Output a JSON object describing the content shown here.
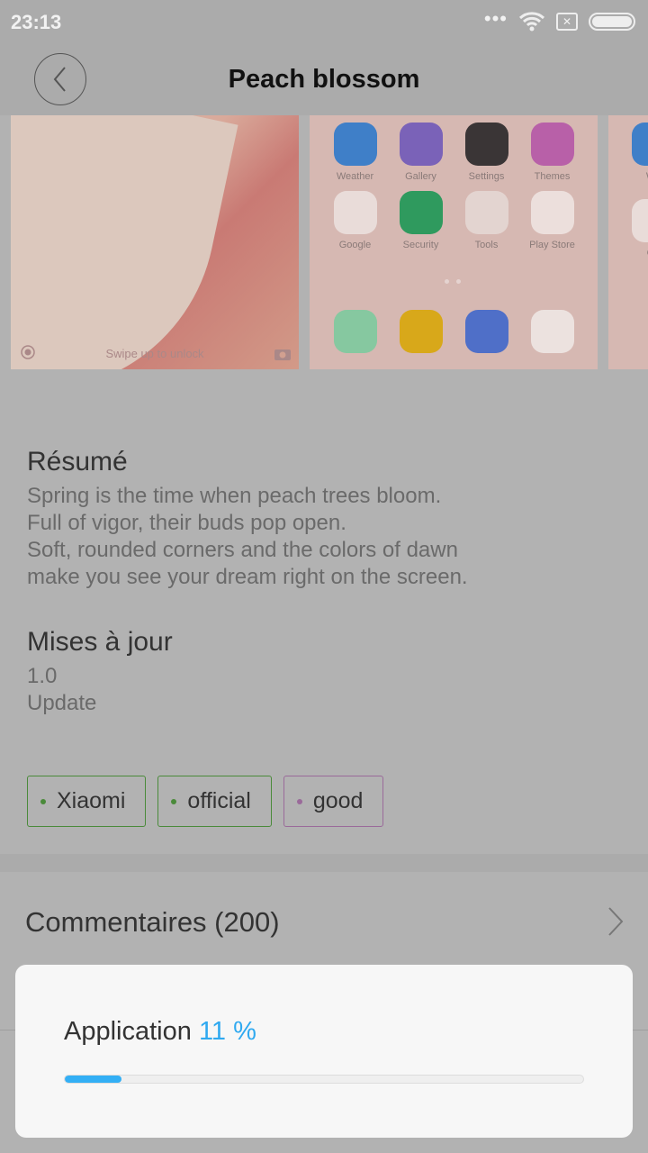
{
  "status_bar": {
    "time": "23:13",
    "icons": [
      "more-dots-icon",
      "wifi-icon",
      "no-sim-icon",
      "battery-icon"
    ]
  },
  "header": {
    "title": "Peach blossom",
    "back_icon": "chevron-left-icon"
  },
  "previews": {
    "lock_screen": {
      "hint": "Swipe up to unlock"
    },
    "home_apps": [
      {
        "label": "Weather",
        "color": "#3f7fc8"
      },
      {
        "label": "Gallery",
        "color": "#7a62b8"
      },
      {
        "label": "Settings",
        "color": "#3a3536"
      },
      {
        "label": "Themes",
        "color": "#b860a8"
      },
      {
        "label": "Google",
        "color": "#e9dcd9"
      },
      {
        "label": "Security",
        "color": "#2f9a5e"
      },
      {
        "label": "Tools",
        "color": "#e3d4d0"
      },
      {
        "label": "Play Store",
        "color": "#ecdfdc"
      }
    ],
    "dock_apps": [
      {
        "name": "phone",
        "color": "#86c8a0"
      },
      {
        "name": "messages",
        "color": "#d8a81a"
      },
      {
        "name": "browser",
        "color": "#4f6fc8"
      },
      {
        "name": "camera",
        "color": "#ece2df"
      }
    ],
    "third_partial": {
      "labels": [
        "We",
        "Go"
      ]
    }
  },
  "summary": {
    "heading": "Résumé",
    "lines": [
      "Spring is the time when peach trees bloom.",
      "Full of vigor, their buds pop open.",
      "Soft, rounded corners and the colors of dawn",
      "make you see your dream right on the screen."
    ]
  },
  "updates": {
    "heading": "Mises à jour",
    "version": "1.0",
    "note": "Update"
  },
  "tags": [
    {
      "label": "Xiaomi",
      "color": "#4a8a3a"
    },
    {
      "label": "official",
      "color": "#4a8a3a"
    },
    {
      "label": "good",
      "color": "#9a6a9a"
    }
  ],
  "comments": {
    "label": "Commentaires (200)"
  },
  "dialog": {
    "label": "Application",
    "percent_text": "11 %",
    "progress": 11,
    "accent": "#33aff5"
  }
}
